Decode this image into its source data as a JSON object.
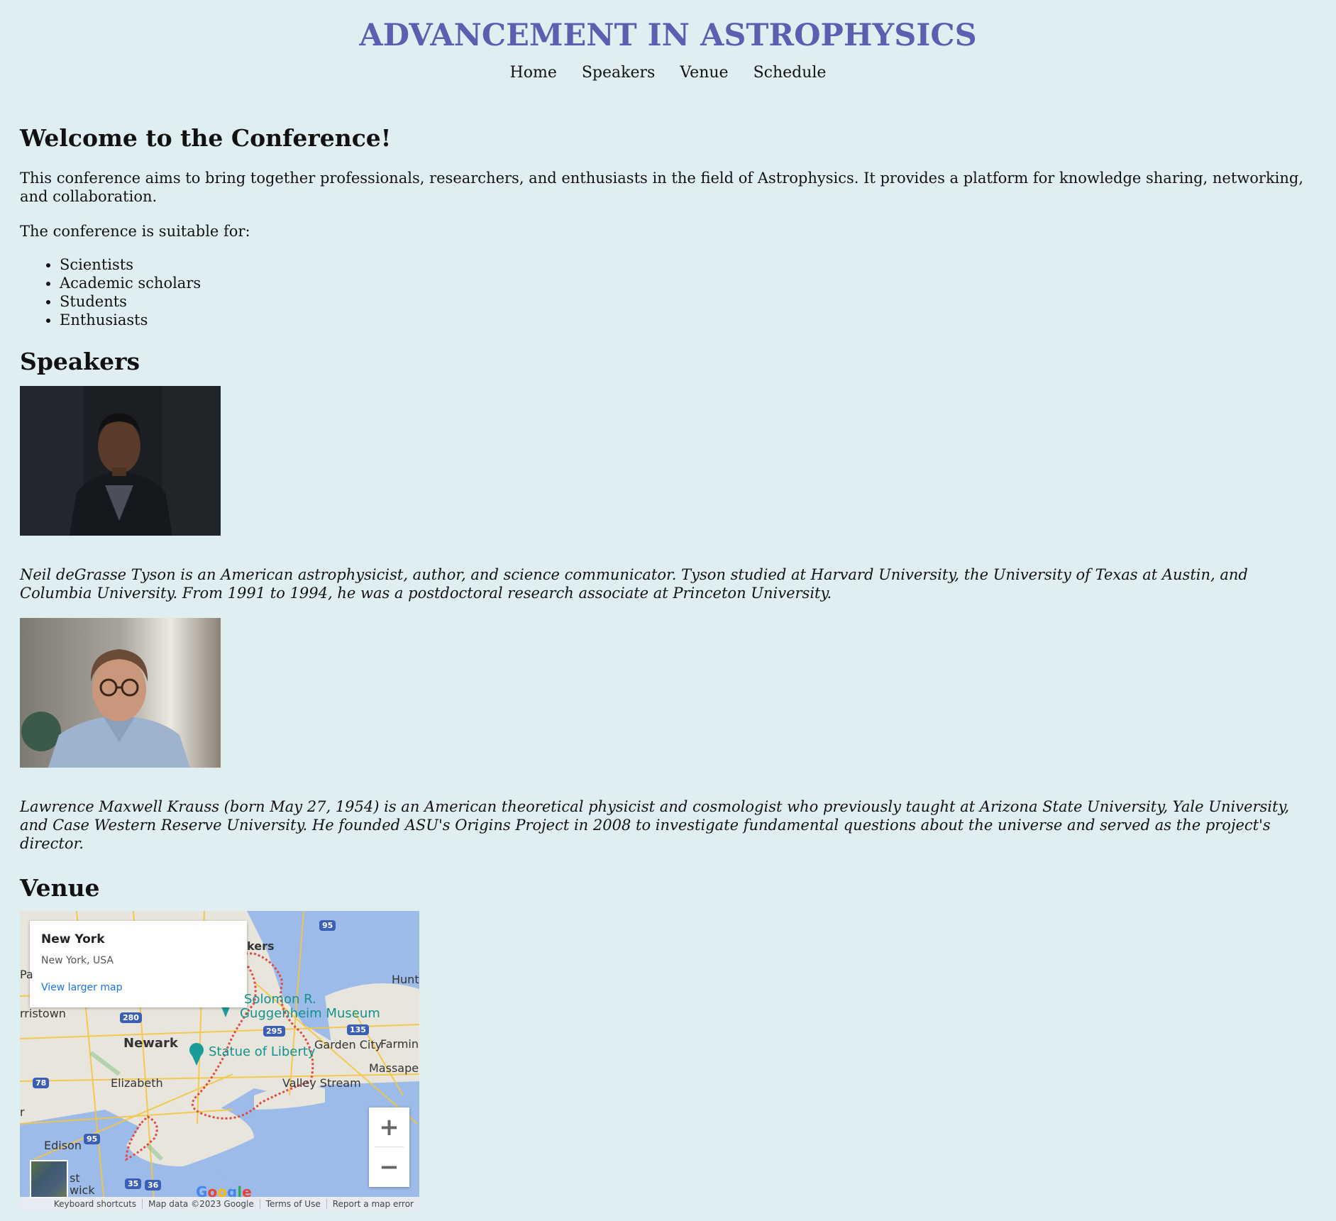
{
  "header": {
    "title": "ADVANCEMENT IN ASTROPHYSICS",
    "nav": [
      "Home",
      "Speakers",
      "Venue",
      "Schedule"
    ]
  },
  "welcome": {
    "heading": "Welcome to the Conference!",
    "intro": "This conference aims to bring together professionals, researchers, and enthusiasts in the field of Astrophysics. It provides a platform for knowledge sharing, networking, and collaboration.",
    "suitable_label": "The conference is suitable for:",
    "audience": [
      "Scientists",
      "Academic scholars",
      "Students",
      "Enthusiasts"
    ]
  },
  "speakers": {
    "heading": "Speakers",
    "items": [
      {
        "bio": "Neil deGrasse Tyson is an American astrophysicist, author, and science communicator. Tyson studied at Harvard University, the University of Texas at Austin, and Columbia University. From 1991 to 1994, he was a postdoctoral research associate at Princeton University."
      },
      {
        "bio": "Lawrence Maxwell Krauss (born May 27, 1954) is an American theoretical physicist and cosmologist who previously taught at Arizona State University, Yale University, and Case Western Reserve University. He founded ASU's Origins Project in 2008 to investigate fundamental questions about the universe and served as the project's director."
      }
    ]
  },
  "venue": {
    "heading": "Venue",
    "map": {
      "place": "New York",
      "address": "New York, USA",
      "larger_link": "View larger map",
      "labels": {
        "yonkers": "kers",
        "morristown": "rristown",
        "newark": "Newark",
        "elizabeth": "Elizabeth",
        "edison": "Edison",
        "garden_city": "Garden City",
        "farming": "Farmin",
        "massapequa": "Massape",
        "valley_stream": "Valley Stream",
        "hunt": "Hunti",
        "brunswick": "wick",
        "st": "st",
        "pa": "Pa",
        "r": "r"
      },
      "pois": {
        "guggenheim_1": "Solomon R.",
        "guggenheim_2": "Guggenheim Museum",
        "liberty": "Statue of Liberty"
      },
      "shields": [
        "95",
        "280",
        "295",
        "135",
        "78",
        "95",
        "35",
        "36"
      ],
      "google": "Google",
      "footer": [
        "Keyboard shortcuts",
        "Map data ©2023 Google",
        "Terms of Use",
        "Report a map error"
      ]
    }
  }
}
